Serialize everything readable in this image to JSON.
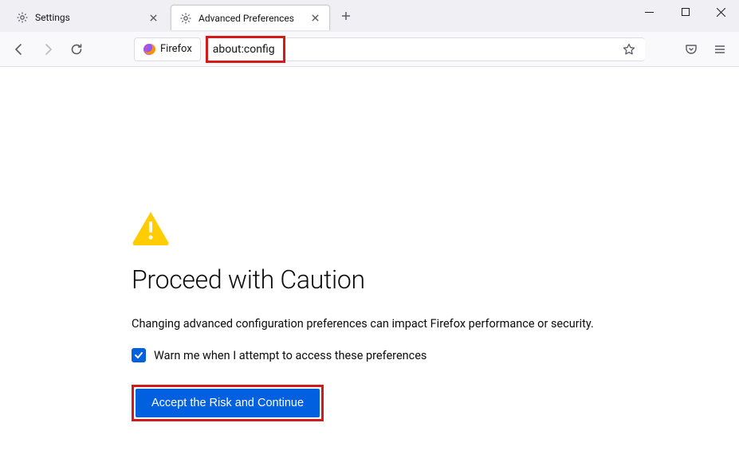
{
  "tabs": [
    {
      "label": "Settings"
    },
    {
      "label": "Advanced Preferences"
    }
  ],
  "url_context_label": "Firefox",
  "url": "about:config",
  "content": {
    "title": "Proceed with Caution",
    "description": "Changing advanced configuration preferences can impact Firefox performance or security.",
    "checkbox_label": "Warn me when I attempt to access these preferences",
    "checkbox_checked": true,
    "button_label": "Accept the Risk and Continue"
  }
}
